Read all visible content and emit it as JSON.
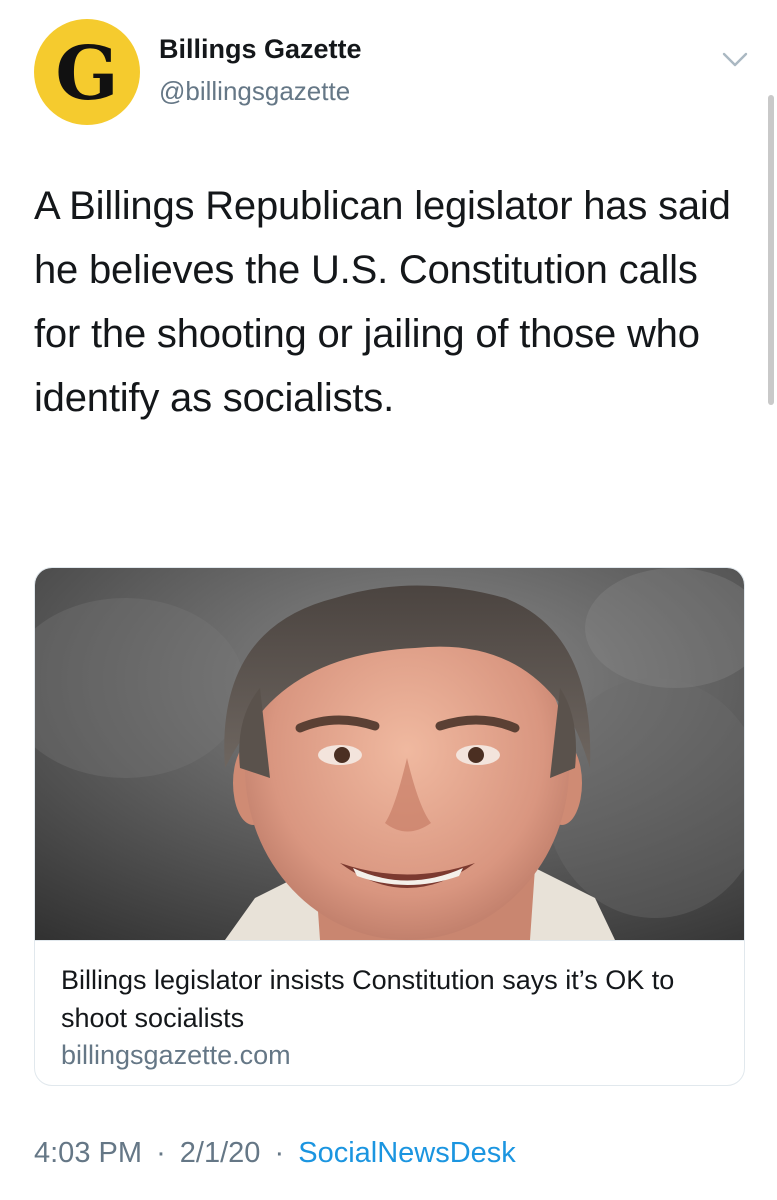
{
  "account": {
    "name": "Billings Gazette",
    "handle": "@billingsgazette",
    "avatar_letter": "G",
    "avatar_color": "#f5cb2e"
  },
  "tweet": {
    "text": "A Billings Republican legislator has said he believes the U.S. Constitution calls for the shooting or jailing of those who identify as socialists."
  },
  "card": {
    "title": "Billings legislator insists Constitution says it’s OK to shoot socialists",
    "domain": "billingsgazette.com"
  },
  "footer": {
    "time": "4:03 PM",
    "separator": "·",
    "date": "2/1/20",
    "source": "SocialNewsDesk"
  },
  "colors": {
    "text_primary": "#14171a",
    "text_secondary": "#657786",
    "link": "#1b95e0",
    "border": "#e1e8ed"
  },
  "icons": {
    "menu": "chevron-down-icon"
  }
}
